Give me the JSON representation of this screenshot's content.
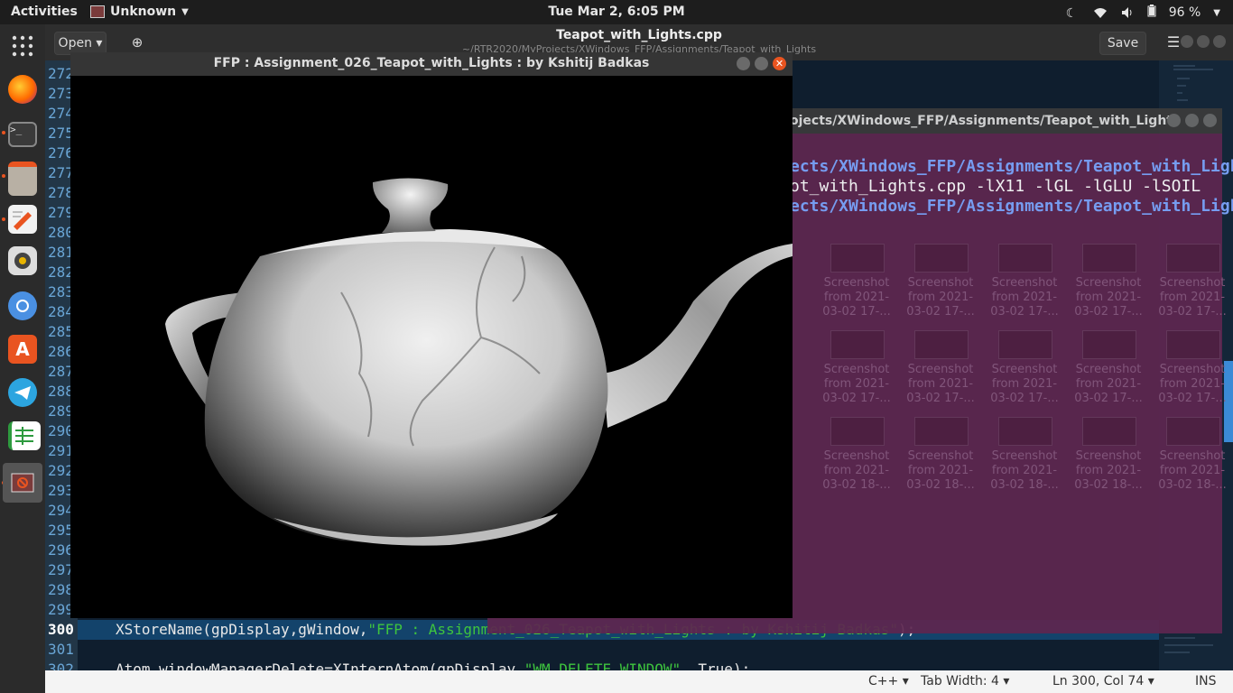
{
  "topbar": {
    "activities": "Activities",
    "app_name": "Unknown",
    "clock": "Tue Mar  2,  6:05 PM",
    "battery": "96 %"
  },
  "gedit": {
    "open_label": "Open",
    "title": "Teapot_with_Lights.cpp",
    "subtitle": "~/RTR2020/MyProjects/XWindows_FFP/Assignments/Teapot_with_Lights",
    "save_label": "Save"
  },
  "editor": {
    "line_numbers": [
      "272",
      "273",
      "274",
      "275",
      "276",
      "277",
      "278",
      "279",
      "280",
      "281",
      "282",
      "283",
      "284",
      "285",
      "286",
      "287",
      "288",
      "289",
      "290",
      "291",
      "292",
      "293",
      "294",
      "295",
      "296",
      "297",
      "298",
      "299",
      "300",
      "301",
      "302"
    ],
    "current_line": "300",
    "line300_code": "XStoreName(gpDisplay,gWindow,",
    "line300_string": "\"FFP : Assignment_026_Teapot_with_Lights : by Kshitij Badkas\"",
    "line300_end": ");",
    "line302_code": "Atom windowManagerDelete=XInternAtom(gpDisplay,",
    "line302_string": "\"WM_DELETE_WINDOW\"",
    "line302_end": ", True);"
  },
  "statusbar": {
    "language": "C++",
    "tab_width": "Tab Width: 4",
    "position": "Ln 300, Col 74",
    "mode": "INS"
  },
  "terminal": {
    "title": "ojects/XWindows_FFP/Assignments/Teapot_with_Lights",
    "line1": "ects/XWindows_FFP/Assignments/Teapot_with_Light",
    "line2": "ot_with_Lights.cpp -lX11 -lGL -lGLU -lSOIL",
    "line3": "ects/XWindows_FFP/Assignments/Teapot_with_Light"
  },
  "files": {
    "label1": "Screenshot",
    "label2": "from 2021-",
    "dates_row1": [
      "03-02 17-...",
      "03-02 17-...",
      "03-02 17-...",
      "03-02 17-...",
      "03-02 17-..."
    ],
    "dates_row2": [
      "03-02 17-...",
      "03-02 17-...",
      "03-02 17-...",
      "03-02 17-...",
      "03-02 17-..."
    ],
    "dates_row3": [
      "03-02 18-...",
      "03-02 18-...",
      "03-02 18-...",
      "03-02 18-...",
      "03-02 18-..."
    ]
  },
  "ffp_window": {
    "title": "FFP : Assignment_026_Teapot_with_Lights : by Kshitij Badkas"
  },
  "colors": {
    "accent": "#e95420",
    "editor_bg": "#0f1e2e",
    "terminal_bg": "#5e2750",
    "string_green": "#3ec43e"
  }
}
